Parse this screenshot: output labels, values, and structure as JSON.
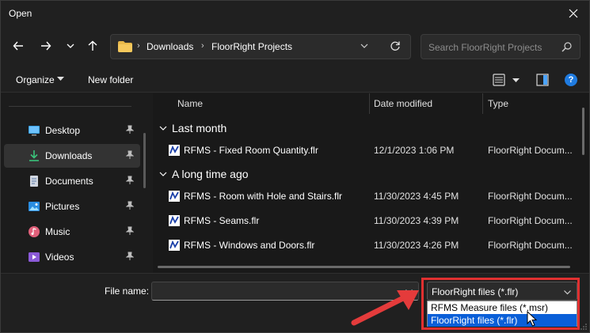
{
  "window": {
    "title": "Open"
  },
  "address": {
    "crumbs": [
      "Downloads",
      "FloorRight Projects"
    ]
  },
  "search": {
    "placeholder": "Search FloorRight Projects"
  },
  "toolbar": {
    "organize_label": "Organize",
    "new_folder_label": "New folder",
    "help_label": "?"
  },
  "sidebar": {
    "items": [
      {
        "label": "Desktop",
        "icon": "desktop-icon",
        "selected": false
      },
      {
        "label": "Downloads",
        "icon": "download-icon",
        "selected": true
      },
      {
        "label": "Documents",
        "icon": "documents-icon",
        "selected": false
      },
      {
        "label": "Pictures",
        "icon": "pictures-icon",
        "selected": false
      },
      {
        "label": "Music",
        "icon": "music-icon",
        "selected": false
      },
      {
        "label": "Videos",
        "icon": "videos-icon",
        "selected": false
      }
    ]
  },
  "columns": {
    "name": "Name",
    "date": "Date modified",
    "type": "Type"
  },
  "groups": [
    {
      "label": "Last month",
      "files": [
        {
          "name": "RFMS - Fixed Room Quantity.flr",
          "date": "12/1/2023 1:06 PM",
          "type": "FloorRight Docum..."
        }
      ]
    },
    {
      "label": "A long time ago",
      "files": [
        {
          "name": "RFMS - Room with Hole and Stairs.flr",
          "date": "11/30/2023 4:45 PM",
          "type": "FloorRight Docum..."
        },
        {
          "name": "RFMS - Seams.flr",
          "date": "11/30/2023 4:39 PM",
          "type": "FloorRight Docum..."
        },
        {
          "name": "RFMS - Windows and Doors.flr",
          "date": "11/30/2023 4:26 PM",
          "type": "FloorRight Docum..."
        }
      ]
    }
  ],
  "footer": {
    "file_name_label": "File name:",
    "file_name_value": "",
    "file_type_selected": "FloorRight files (*.flr)",
    "file_type_options": [
      "RFMS Measure files (*.msr)",
      "FloorRight files (*.flr)"
    ]
  },
  "colors": {
    "highlight_box": "#e03030",
    "selected_option": "#0a5fd8",
    "help_icon": "#1f7be0"
  }
}
